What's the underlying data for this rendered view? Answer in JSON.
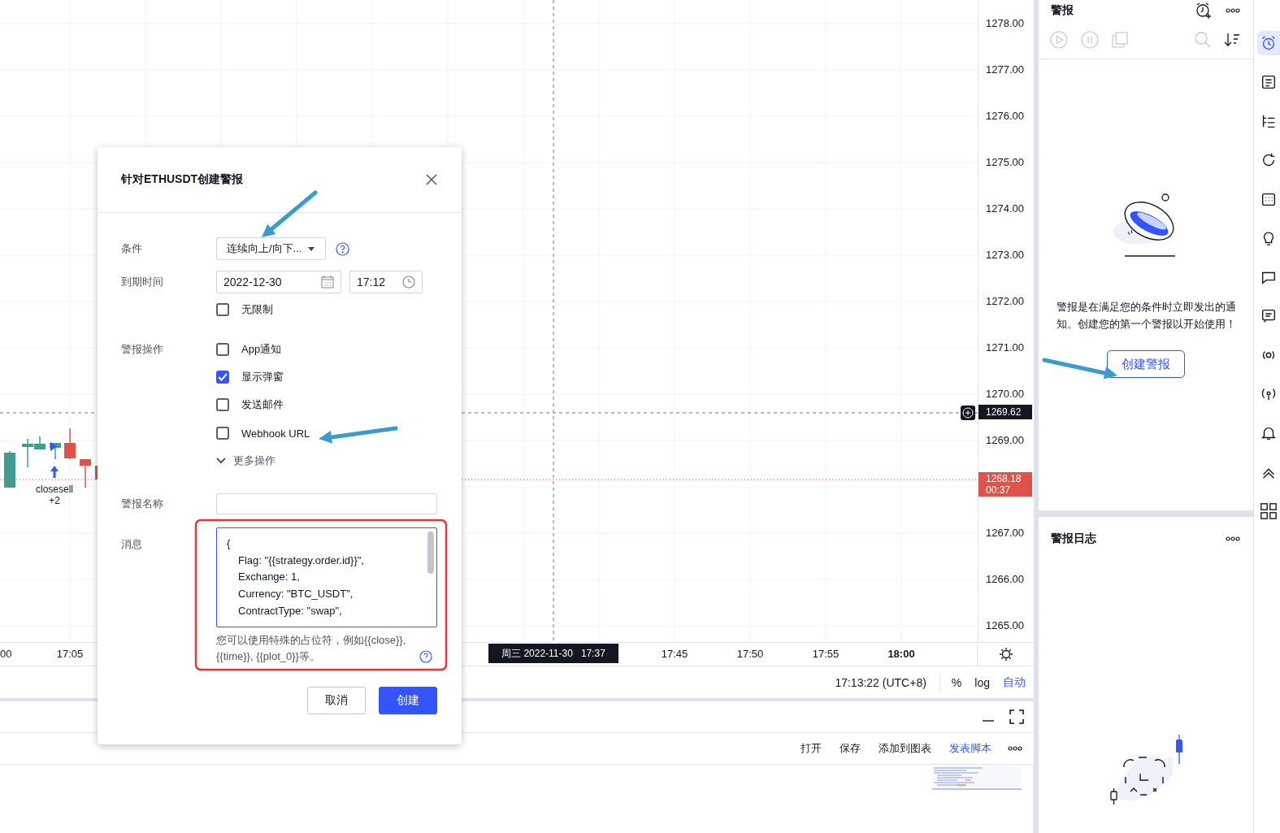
{
  "chart": {
    "signal_label": "closesell",
    "signal_count": "+2"
  },
  "price_axis": {
    "labels": [
      "1278.00",
      "1277.00",
      "1276.00",
      "1275.00",
      "1274.00",
      "1273.00",
      "1272.00",
      "1271.00",
      "1270.00",
      "1269.00",
      "1267.00",
      "1266.00",
      "1265.00"
    ],
    "crosshair_price": "1269.62",
    "last_price": "1268.18",
    "countdown": "00:37"
  },
  "time_axis": {
    "ticks": [
      {
        "label": "00",
        "bold": false
      },
      {
        "label": "17:05",
        "bold": false
      },
      {
        "label": "17:45",
        "bold": false
      },
      {
        "label": "17:50",
        "bold": false
      },
      {
        "label": "17:55",
        "bold": false
      },
      {
        "label": "18:00",
        "bold": true
      }
    ],
    "crosshair_time": "周三 2022-11-30   17:37"
  },
  "status_bar": {
    "clock": "17:13:22 (UTC+8)",
    "scale_buttons": [
      {
        "label": "%",
        "selected": false
      },
      {
        "label": "log",
        "selected": false
      },
      {
        "label": "自动",
        "selected": true
      }
    ]
  },
  "editor": {
    "actions": [
      {
        "label": "打开",
        "kind": "plain"
      },
      {
        "label": "保存",
        "kind": "plain"
      },
      {
        "label": "添加到图表",
        "kind": "plain"
      },
      {
        "label": "发表脚本",
        "kind": "accent"
      }
    ]
  },
  "alerts_panel": {
    "title": "警报",
    "empty_text": "警报是在满足您的条件时立即发出的通知。创建您的第一个警报以开始使用！",
    "create_button": "创建警报"
  },
  "log_panel": {
    "title": "警报日志"
  },
  "toolbar": [
    {
      "selected": true
    },
    {
      "selected": false
    },
    {
      "selected": false
    },
    {
      "selected": false
    },
    {
      "selected": false
    },
    {
      "selected": false
    },
    {
      "selected": false
    },
    {
      "selected": false
    },
    {
      "selected": false
    },
    {
      "selected": false
    },
    {
      "selected": false
    },
    {
      "selected": false
    },
    {
      "selected": false
    }
  ],
  "dialog": {
    "title": "针对ETHUSDT创建警报",
    "condition": {
      "label": "条件",
      "value": "连续向上/向下..."
    },
    "expiry": {
      "label": "到期时间",
      "date": "2022-12-30",
      "time": "17:12",
      "unlimited": {
        "label": "无限制",
        "checked": false
      }
    },
    "actions": {
      "label": "警报操作",
      "options": [
        {
          "label": "App通知",
          "checked": false
        },
        {
          "label": "显示弹窗",
          "checked": true
        },
        {
          "label": "发送邮件",
          "checked": false
        },
        {
          "label": "Webhook URL",
          "checked": false
        }
      ],
      "more": "更多操作"
    },
    "name": {
      "label": "警报名称"
    },
    "message": {
      "label": "消息",
      "open": "{",
      "fields": [
        "Flag: \"{{strategy.order.id}}\",",
        "Exchange: 1,",
        "Currency: \"BTC_USDT\",",
        "ContractType: \"swap\","
      ],
      "hint": "您可以使用特殊的占位符，例如{{close}}, {{time}}, {{plot_0}}等。"
    },
    "buttons": [
      {
        "label": "取消",
        "kind": "secondary"
      },
      {
        "label": "创建",
        "kind": "primary"
      }
    ]
  }
}
